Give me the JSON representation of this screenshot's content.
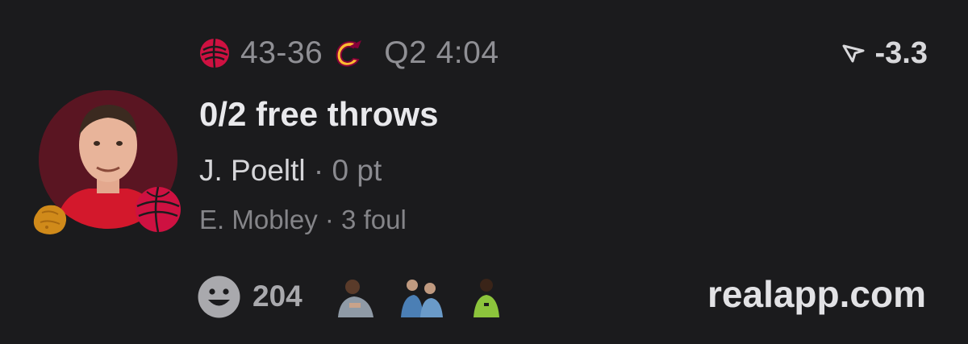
{
  "header": {
    "home_team_icon": "raptors-logo-icon",
    "score": "43-36",
    "away_team_icon": "cavaliers-logo-icon",
    "clock": "Q2 4:04",
    "spread_icon": "arrow-pointer-icon",
    "spread_value": "-3.3"
  },
  "event": {
    "title": "0/2 free throws",
    "player_name": "J. Poeltl",
    "player_stat": "· 0 pt",
    "secondary_line": "E. Mobley · 3 foul",
    "avatar_icon": "player-avatar",
    "badges": [
      "basketball-badge-icon",
      "nugget-badge-icon"
    ]
  },
  "footer": {
    "reaction_icon": "smiley-face-icon",
    "reaction_count": "204",
    "reactors": [
      "reactor-avatar-1",
      "reactor-avatar-2",
      "reactor-avatar-3"
    ],
    "brand": "realapp.com"
  },
  "colors": {
    "background": "#1b1b1d",
    "raptors_red": "#ce1141",
    "cavs_gold": "#fdbb30",
    "cavs_wine": "#860038",
    "avatar_bg": "#5a1522"
  }
}
